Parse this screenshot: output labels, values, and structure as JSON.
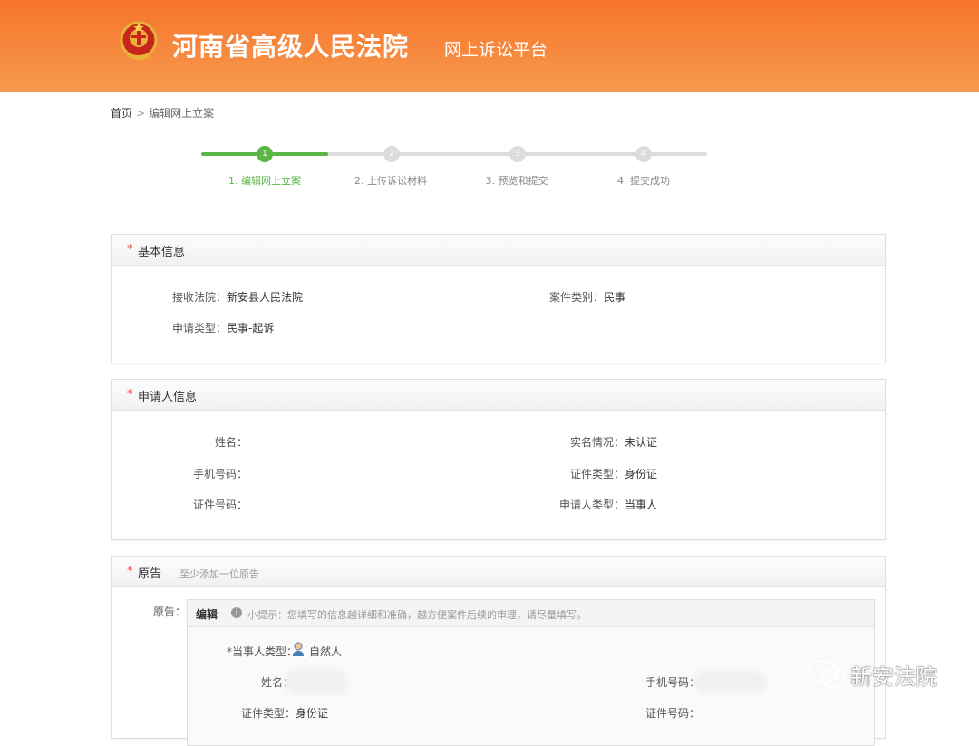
{
  "header": {
    "title": "河南省高级人民法院",
    "subtitle": "网上诉讼平台",
    "emblem_icon": "court-emblem-icon",
    "bg_color": "#f5742a"
  },
  "breadcrumb": {
    "home": "首页",
    "separator": ">",
    "current": "编辑网上立案"
  },
  "steps": [
    {
      "number": "1",
      "label": "1. 编辑网上立案",
      "state": "active"
    },
    {
      "number": "2",
      "label": "2. 上传诉讼材料",
      "state": "pending"
    },
    {
      "number": "3",
      "label": "3. 预览和提交",
      "state": "pending"
    },
    {
      "number": "4",
      "label": "4. 提交成功",
      "state": "pending"
    }
  ],
  "progress_fraction": 0.25,
  "basic_info": {
    "required_mark": "*",
    "title": "基本信息",
    "court_label": "接收法院：",
    "court_value": "新安县人民法院",
    "case_type_label": "案件类别：",
    "case_type_value": "民事",
    "apply_type_label": "申请类型：",
    "apply_type_value": "民事-起诉"
  },
  "applicant": {
    "required_mark": "*",
    "title": "申请人信息",
    "name_label": "姓名：",
    "name_value": "",
    "verify_label": "实名情况：",
    "verify_value": "未认证",
    "phone_label": "手机号码：",
    "phone_value": "",
    "id_type_label": "证件类型：",
    "id_type_value": "身份证",
    "id_no_label": "证件号码：",
    "id_no_value": "",
    "applicant_type_label": "申请人类型：",
    "applicant_type_value": "当事人"
  },
  "plaintiff": {
    "required_mark": "*",
    "title": "原告",
    "hint": "至少添加一位原告",
    "row_label": "原告：",
    "edit_tab": "编辑",
    "info_icon": "info-icon",
    "tip": "小提示：您填写的信息越详细和准确，越方便案件后续的审理，请尽量填写。",
    "party_type_label": "*当事人类型：",
    "party_type_value": "自然人",
    "party_icon": "person-icon",
    "name_label": "姓名：",
    "phone_label": "手机号码：",
    "id_type_label": "证件类型：",
    "id_type_value": "身份证",
    "id_no_label": "证件号码："
  },
  "watermark": {
    "icon": "wechat-icon",
    "text": "新安法院"
  }
}
